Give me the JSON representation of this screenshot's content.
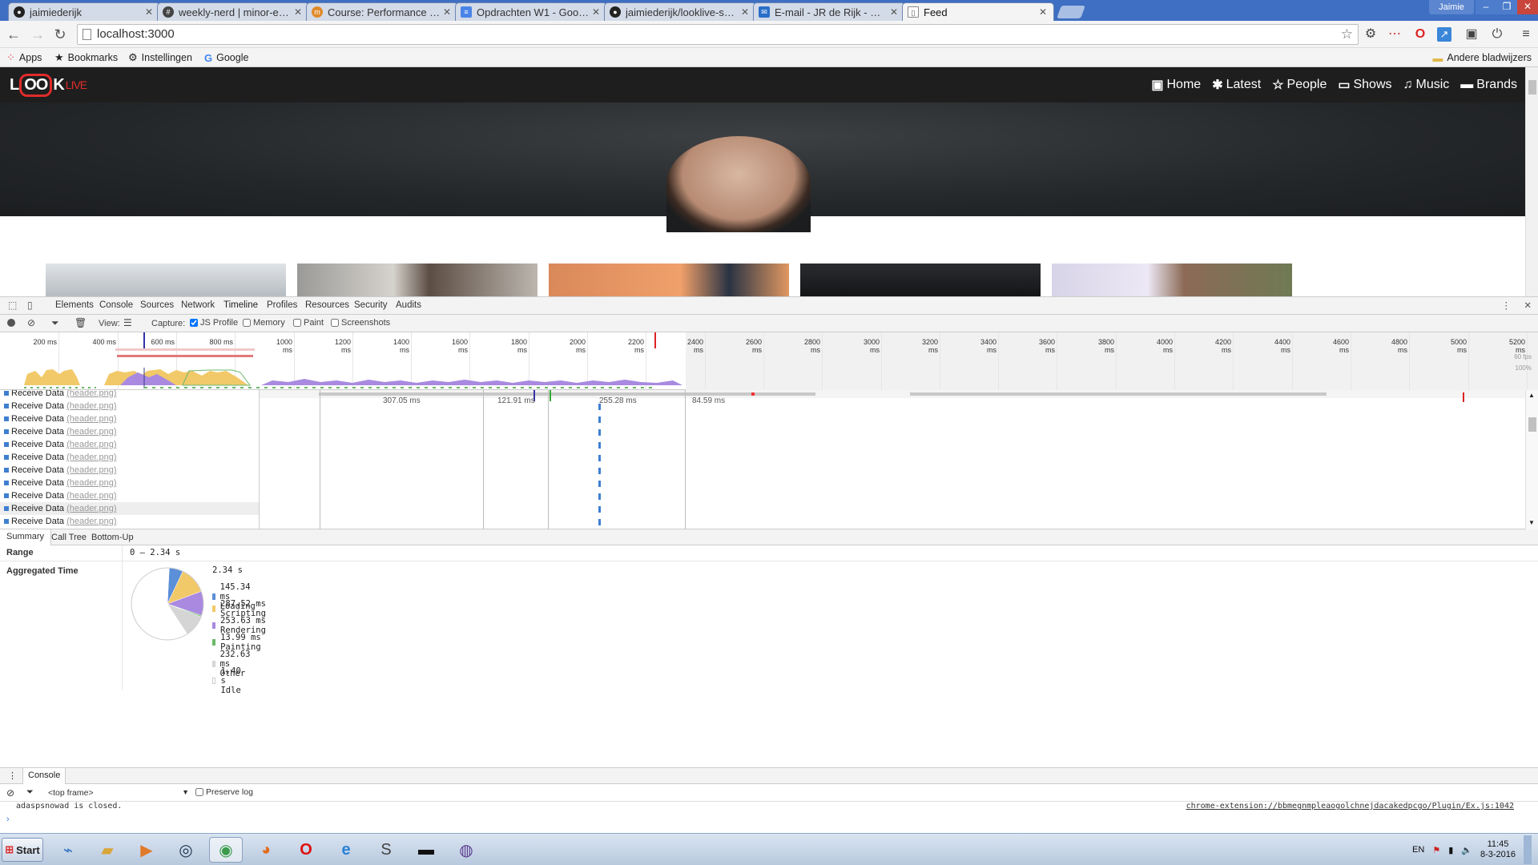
{
  "browser": {
    "tabs": [
      {
        "title": "jaimiederijk",
        "icon": "github-icon"
      },
      {
        "title": "weekly-nerd | minor-every",
        "icon": "slack-icon"
      },
      {
        "title": "Course: Performance Matt",
        "icon": "moodle-icon"
      },
      {
        "title": "Opdrachten W1 - Google",
        "icon": "google-docs-icon"
      },
      {
        "title": "jaimiederijk/looklive-serve",
        "icon": "github-icon"
      },
      {
        "title": "E-mail - JR de Rijk - Outlo",
        "icon": "mail-icon"
      },
      {
        "title": "Feed",
        "icon": "page-icon"
      }
    ],
    "user": "Jaimie",
    "url": "localhost:3000",
    "bookmarks": [
      "Apps",
      "Bookmarks",
      "Instellingen",
      "Google"
    ],
    "other_bookmarks": "Andere bladwijzers"
  },
  "site": {
    "logo": {
      "a": "L",
      "b": "OO",
      "c": "K",
      "live": "LIVE"
    },
    "nav": [
      "Home",
      "Latest",
      "People",
      "Shows",
      "Music",
      "Brands"
    ]
  },
  "devtools": {
    "tabs": [
      "Elements",
      "Console",
      "Sources",
      "Network",
      "Timeline",
      "Profiles",
      "Resources",
      "Security",
      "Audits"
    ],
    "view_label": "View:",
    "capture_label": "Capture:",
    "capture_options": [
      {
        "label": "JS Profile",
        "checked": true
      },
      {
        "label": "Memory",
        "checked": false
      },
      {
        "label": "Paint",
        "checked": false
      },
      {
        "label": "Screenshots",
        "checked": false
      }
    ],
    "ruler": [
      "200 ms",
      "400 ms",
      "600 ms",
      "800 ms",
      "1000 ms",
      "1200 ms",
      "1400 ms",
      "1600 ms",
      "1800 ms",
      "2000 ms",
      "2200 ms",
      "2400 ms",
      "2600 ms",
      "2800 ms",
      "3000 ms",
      "3200 ms",
      "3400 ms",
      "3600 ms",
      "3800 ms",
      "4000 ms",
      "4200 ms",
      "4400 ms",
      "4600 ms",
      "4800 ms",
      "5000 ms",
      "5200 ms"
    ],
    "side_ticks": [
      "60 fps",
      "100%"
    ],
    "flame_labels": [
      "307.05 ms",
      "121.91 ms",
      "255.28 ms",
      "84.59 ms"
    ],
    "rows": {
      "label": "Receive Data",
      "link": "(header.png)",
      "count": 13
    },
    "summary_tabs": [
      "Summary",
      "Call Tree",
      "Bottom-Up"
    ],
    "range_label": "Range",
    "range_value": "0 – 2.34 s",
    "aggregated_label": "Aggregated Time",
    "total": "2.34 s",
    "legend": [
      {
        "text": "145.34 ms Loading",
        "color": "#5b8fd8"
      },
      {
        "text": "287.52 ms Scripting",
        "color": "#f2c968"
      },
      {
        "text": "253.63 ms Rendering",
        "color": "#a98ae0"
      },
      {
        "text": "13.99 ms Painting",
        "color": "#6cb86b"
      },
      {
        "text": "232.63 ms Other",
        "color": "#d5d5d5"
      },
      {
        "text": "1.40 s Idle",
        "color": "#ffffff"
      }
    ],
    "drawer_tab": "Console",
    "frame_select": "<top frame>",
    "preserve_log": "Preserve log",
    "console_line": "adaspsnowad is closed.",
    "console_source": "chrome-extension://bbmegnmpleaogolchnejdacakedpcgo/Plugin/Ex.js:1042"
  },
  "taskbar": {
    "start": "Start",
    "lang": "EN",
    "time": "11:45",
    "date": "8-3-2016"
  }
}
